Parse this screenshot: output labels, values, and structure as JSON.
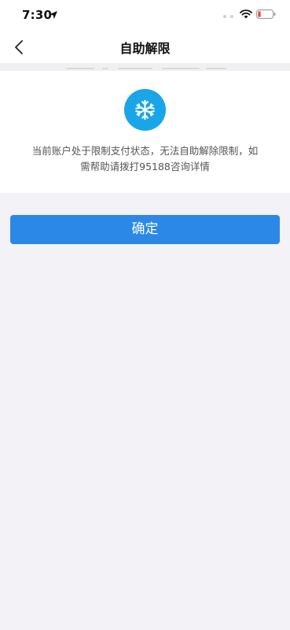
{
  "status_bar": {
    "time": "7:30",
    "icons": [
      "location-arrow-icon",
      "signal-dots-icon",
      "wifi-icon",
      "battery-icon"
    ],
    "battery_color": "#e5443a"
  },
  "nav": {
    "title": "自助解限",
    "back_icon": "chevron-left-icon"
  },
  "notice": {
    "icon": "snowflake-icon",
    "icon_bg": "#1aa5e8",
    "message": "当前账户处于限制支付状态，无法自助解除限制，如需帮助请拨打95188咨询详情"
  },
  "actions": {
    "confirm_label": "确定",
    "accent": "#2c88e6"
  }
}
